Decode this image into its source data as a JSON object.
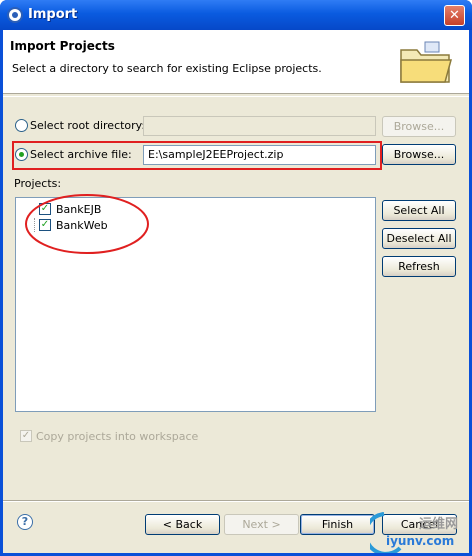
{
  "window": {
    "title": "Import",
    "close_glyph": "✕"
  },
  "banner": {
    "title": "Import Projects",
    "description": "Select a directory to search for existing Eclipse projects.",
    "icon": "folder-icon"
  },
  "source": {
    "root_directory_label": "Select root directory:",
    "root_directory_value": "",
    "root_browse_label": "Browse...",
    "archive_file_label": "Select archive file:",
    "archive_file_value": "E:\\sampleJ2EEProject.zip",
    "archive_browse_label": "Browse...",
    "selected": "archive"
  },
  "projects": {
    "label": "Projects:",
    "items": [
      {
        "name": "BankEJB",
        "checked": true
      },
      {
        "name": "BankWeb",
        "checked": true
      }
    ],
    "select_all_label": "Select All",
    "deselect_all_label": "Deselect All",
    "refresh_label": "Refresh"
  },
  "options": {
    "copy_projects_label": "Copy projects into workspace",
    "copy_projects_checked": true,
    "copy_projects_enabled": false
  },
  "footer": {
    "help_glyph": "?",
    "back_label": "< Back",
    "next_label": "Next >",
    "finish_label": "Finish",
    "cancel_label": "Cancel"
  },
  "watermark": {
    "text1": "运维网",
    "text2": "iyunv.com"
  },
  "colors": {
    "highlight_annotation": "#e02020",
    "titlebar": "#0a5be0",
    "dialog_background": "#ece9d8"
  }
}
